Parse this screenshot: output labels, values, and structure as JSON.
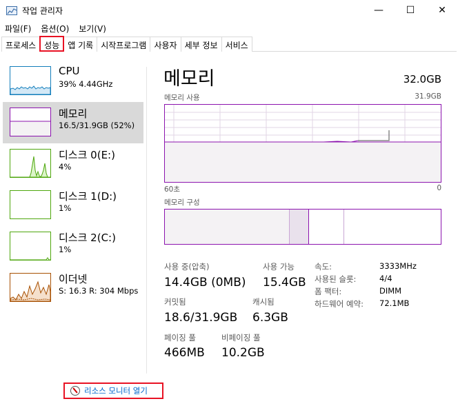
{
  "window": {
    "title": "작업 관리자",
    "minimize_glyph": "—",
    "maximize_glyph": "☐",
    "close_glyph": "✕"
  },
  "menu": [
    "파일(F)",
    "옵션(O)",
    "보기(V)"
  ],
  "tabs": [
    "프로세스",
    "성능",
    "앱 기록",
    "시작프로그램",
    "사용자",
    "세부 정보",
    "서비스"
  ],
  "active_tab": "성능",
  "sidebar": {
    "cpu": {
      "name": "CPU",
      "sub": "39%  4.44GHz",
      "color": "#117dbb"
    },
    "memory": {
      "name": "메모리",
      "sub": "16.5/31.9GB (52%)",
      "color": "#8b12ae"
    },
    "disk0": {
      "name": "디스크 0(E:)",
      "sub": "4%",
      "color": "#4da60c"
    },
    "disk1": {
      "name": "디스크 1(D:)",
      "sub": "1%",
      "color": "#4da60c"
    },
    "disk2": {
      "name": "디스크 2(C:)",
      "sub": "1%",
      "color": "#4da60c"
    },
    "ethernet": {
      "name": "이더넷",
      "sub": "S: 16.3  R: 304 Mbps",
      "color": "#a74f01"
    }
  },
  "main": {
    "title": "메모리",
    "total": "32.0GB",
    "usage_label": "메모리 사용",
    "usage_max": "31.9GB",
    "time_left": "60초",
    "time_right": "0",
    "composition_label": "메모리 구성",
    "usage_fraction": 0.52
  },
  "stats": {
    "in_use_label": "사용 중(압축)",
    "in_use_value": "14.4GB (0MB)",
    "available_label": "사용 가능",
    "available_value": "15.4GB",
    "committed_label": "커밋됨",
    "committed_value": "18.6/31.9GB",
    "cached_label": "캐시됨",
    "cached_value": "6.3GB",
    "paged_label": "페이징 풀",
    "paged_value": "466MB",
    "nonpaged_label": "비페이징 풀",
    "nonpaged_value": "10.2GB"
  },
  "details": {
    "speed_key": "속도:",
    "speed_val": "3333MHz",
    "slots_key": "사용된 슬롯:",
    "slots_val": "4/4",
    "form_key": "폼 팩터:",
    "form_val": "DIMM",
    "reserved_key": "하드웨어 예약:",
    "reserved_val": "72.1MB"
  },
  "footer": {
    "resource_monitor": "리소스 모니터 열기"
  }
}
